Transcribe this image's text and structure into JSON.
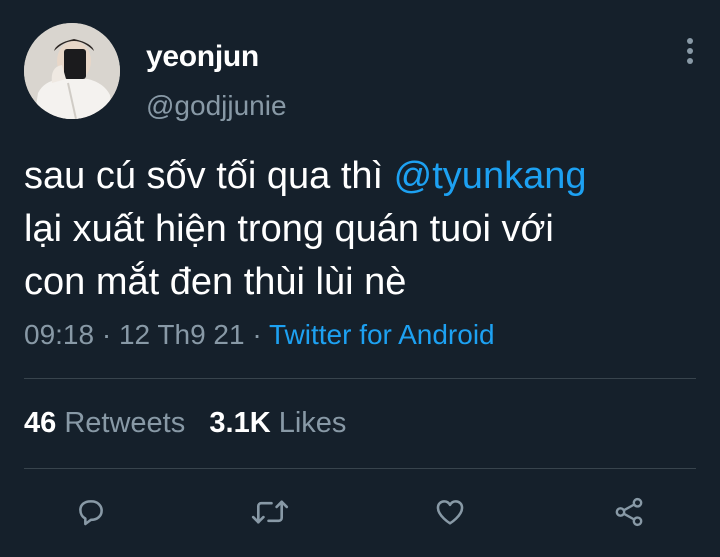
{
  "user": {
    "display_name": "yeonjun",
    "handle": "@godjjunie"
  },
  "tweet": {
    "line1_text": "sau cú sốv tối qua thì ",
    "line1_mention": "@tyunkang",
    "line2": "lại xuất hiện trong quán tuoi với",
    "line3": "con mắt đen thùi lùi nè"
  },
  "meta": {
    "time": "09:18",
    "separator": " · ",
    "date": "12 Th9 21",
    "source": "Twitter for Android"
  },
  "stats": {
    "retweets_count": "46",
    "retweets_label": "Retweets",
    "likes_count": "3.1K",
    "likes_label": "Likes"
  },
  "icons": {
    "reply": "reply-icon",
    "retweet": "retweet-icon",
    "like": "heart-icon",
    "share": "share-icon",
    "more": "more-vertical-icon"
  },
  "colors": {
    "background": "#15202b",
    "text": "#ffffff",
    "secondary": "#8899a6",
    "accent": "#1da1f2",
    "divider": "#38444d"
  }
}
